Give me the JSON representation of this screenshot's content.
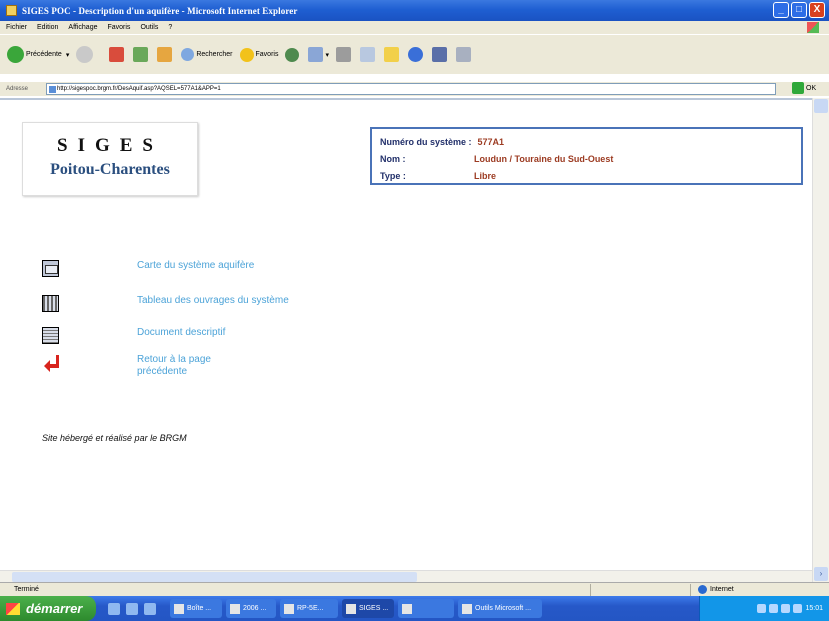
{
  "window": {
    "title": "SIGES POC - Description d'un aquifère - Microsoft Internet Explorer",
    "min_symbol": "_",
    "max_symbol": "□",
    "close_symbol": "X"
  },
  "menubar": {
    "items": [
      "Fichier",
      "Edition",
      "Affichage",
      "Favoris",
      "Outils",
      "?"
    ]
  },
  "toolbar": {
    "back_label": "Précédente",
    "back_dropdown": "▾",
    "search_label": "Rechercher",
    "favorites_label": "Favoris",
    "mail_dropdown": "▾"
  },
  "addressbar": {
    "label": "Adresse",
    "url": "http://sigespoc.brgm.fr/DesAquif.asp?AQSEL=577A1&APP=1",
    "go_label": "OK"
  },
  "page": {
    "logo": {
      "line1": "SIGES",
      "line2": "Poitou-Charentes"
    },
    "info": [
      {
        "key": "Numéro du système :",
        "value": "577A1"
      },
      {
        "key": "Nom :",
        "value": "Loudun / Touraine du Sud-Ouest"
      },
      {
        "key": "Type :",
        "value": "Libre"
      }
    ],
    "links": {
      "map": "Carte du système aquifère",
      "table": "Tableau des ouvrages du système",
      "doc": "Document descriptif",
      "back": "Retour à la page précédente"
    },
    "footer": "Site hébergé et réalisé par le BRGM"
  },
  "statusbar": {
    "status": "Terminé",
    "zone": "Internet"
  },
  "taskbar": {
    "start_label": "démarrer",
    "tasks": [
      "Boîte ...",
      "2006 ...",
      "RP-5E...",
      "SIGES ...",
      "",
      "Outils Microsoft ..."
    ],
    "clock": "15:01"
  },
  "colors": {
    "accent_link": "#4ca3d8",
    "info_border": "#4a73b8",
    "title_bar": "#1f5fd2"
  }
}
